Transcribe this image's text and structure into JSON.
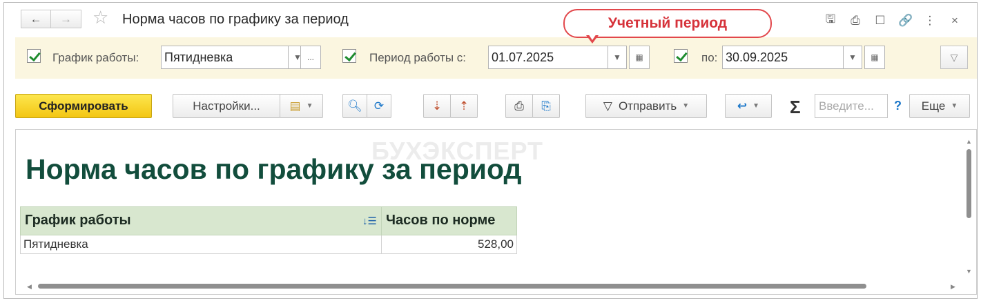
{
  "window": {
    "title": "Норма часов по графику за период",
    "nav_back": "←",
    "nav_forward": "→",
    "icons": [
      "save-icon",
      "print-icon",
      "preview-icon",
      "link-icon",
      "more-vertical-icon",
      "close-icon"
    ]
  },
  "callout": {
    "text": "Учетный период"
  },
  "filters": {
    "schedule_label": "График работы:",
    "schedule_value": "Пятидневка",
    "period_from_label": "Период работы с:",
    "period_from_value": "01.07.2025",
    "period_to_label": "по:",
    "period_to_value": "30.09.2025",
    "choose_button": "..."
  },
  "toolbar": {
    "generate_label": "Сформировать",
    "settings_label": "Настройки...",
    "send_label": "Отправить",
    "search_placeholder": "Введите...",
    "help_label": "?",
    "more_label": "Еще"
  },
  "report": {
    "watermark": "БУХЭКСПЕРТ",
    "title": "Норма часов по графику за период",
    "columns": [
      "График работы",
      "Часов по норме"
    ],
    "rows": [
      [
        "Пятидневка",
        "528,00"
      ]
    ]
  },
  "colors": {
    "accent_yellow": "#f3c613",
    "header_green": "#d8e7cf",
    "title_green": "#124d3c",
    "callout_red": "#e2474b",
    "filter_bg": "#fbf6e0"
  }
}
